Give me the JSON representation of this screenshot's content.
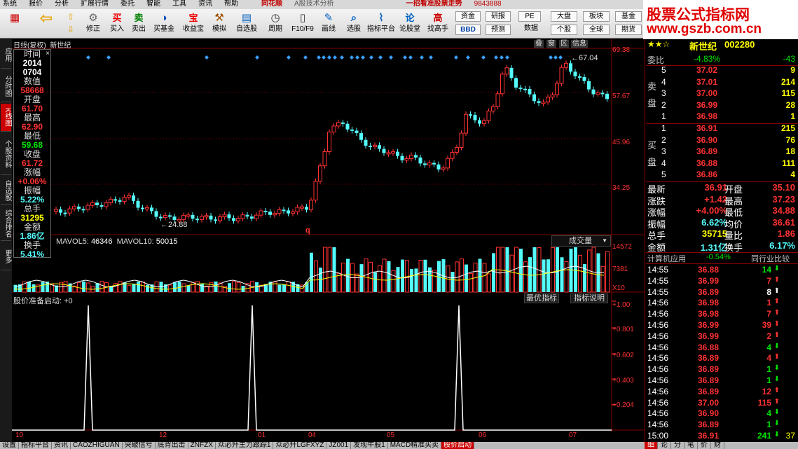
{
  "menu": [
    "系统",
    "报价",
    "分析",
    "扩展行情",
    "委托",
    "智能",
    "工具",
    "资讯",
    "帮助"
  ],
  "app_title": "A股技术分析",
  "app_brand": "同花顺",
  "promo": "一招看准股票走势",
  "promo_num": "9843888",
  "logo": {
    "line1": "股票公式指标网",
    "line2": "www.gszb.com.cn"
  },
  "toolbar": {
    "buttons": [
      "",
      "",
      "修正",
      "买入",
      "卖出",
      "买基金",
      "收益宝",
      "模拟",
      "自选股",
      "周期",
      "F10/F9",
      "画线",
      "选股",
      "指标平台",
      "论股堂",
      "找高手",
      "",
      "数据"
    ],
    "small": [
      "资金",
      "研报",
      "大盘",
      "板块",
      "基金",
      "BBD",
      "预测",
      "个股",
      "全球",
      "期货",
      "PE"
    ]
  },
  "chart_title": "日线(复权)",
  "stock_name_left": "新世纪",
  "chart_tabs": [
    "叠",
    "窗",
    "区",
    "信息"
  ],
  "info": {
    "rows": [
      {
        "label": "时间",
        "value": "2014",
        "cls": "white"
      },
      {
        "label": "",
        "value": "0704",
        "cls": "white"
      },
      {
        "label": "数值",
        "value": "58668",
        "cls": "red"
      },
      {
        "label": "开盘",
        "value": "61.70",
        "cls": "red"
      },
      {
        "label": "最高",
        "value": "62.90",
        "cls": "red"
      },
      {
        "label": "最低",
        "value": "59.68",
        "cls": "green"
      },
      {
        "label": "收盘",
        "value": "61.72",
        "cls": "red"
      },
      {
        "label": "涨幅",
        "value": "+0.06%",
        "cls": "red"
      },
      {
        "label": "振幅",
        "value": "5.22%",
        "cls": "cyan"
      },
      {
        "label": "总手",
        "value": "31295",
        "cls": "yellow"
      },
      {
        "label": "金额",
        "value": "1.86亿",
        "cls": "cyan"
      },
      {
        "label": "换手",
        "value": "5.41%",
        "cls": "cyan"
      }
    ]
  },
  "price_axis": [
    "69.38",
    "57.67",
    "45.96",
    "34.25"
  ],
  "annotations": {
    "high": "67.04",
    "low": "24.88"
  },
  "volume": {
    "legend_ma5_label": "MAVOL5:",
    "legend_ma5": "46346",
    "legend_ma10_label": "MAVOL10:",
    "legend_ma10": "50015",
    "select": "成交量",
    "axis": [
      "14572",
      "7381",
      "X10"
    ]
  },
  "indicator": {
    "legend": "股价准备启动: +0",
    "btn1": "最优指标",
    "btn2": "指标说明",
    "axis": [
      "+1.00",
      "+0.801",
      "+0.602",
      "+0.403",
      "+0.204"
    ]
  },
  "x_axis": [
    "10",
    "12",
    "01",
    "04",
    "05",
    "06",
    "07"
  ],
  "left_tabs": [
    "应用",
    "分时图",
    "K线图",
    "个股资料",
    "自选股",
    "综合排名",
    "更多"
  ],
  "bottom_tabs": [
    "设置",
    "指标平台",
    "资讯",
    "CAOZHIGUAN",
    "突破信号",
    "底背出击",
    "ZNFZX",
    "众必升主力跟踪1",
    "众必升LGFXYZ",
    "JZ001",
    "发现牛股1",
    "MACD精准买卖",
    "股价启动"
  ],
  "right_bottom_tabs": [
    "细",
    "论",
    "分",
    "笔",
    "价",
    "财"
  ],
  "quote": {
    "name": "新世纪",
    "code": "002280",
    "weibi_label": "委比",
    "weibi": "-4.83%",
    "weicha": "-43",
    "sell_label": "卖盘",
    "buy_label": "买盘",
    "sell": [
      {
        "n": "5",
        "p": "37.02",
        "v": "9"
      },
      {
        "n": "4",
        "p": "37.01",
        "v": "214"
      },
      {
        "n": "3",
        "p": "37.00",
        "v": "115"
      },
      {
        "n": "2",
        "p": "36.99",
        "v": "28"
      },
      {
        "n": "1",
        "p": "36.98",
        "v": "1"
      }
    ],
    "buy": [
      {
        "n": "1",
        "p": "36.91",
        "v": "215"
      },
      {
        "n": "2",
        "p": "36.90",
        "v": "76"
      },
      {
        "n": "3",
        "p": "36.89",
        "v": "18"
      },
      {
        "n": "4",
        "p": "36.88",
        "v": "111"
      },
      {
        "n": "5",
        "p": "36.86",
        "v": "4"
      }
    ],
    "stats": [
      {
        "l1": "最新",
        "v1": "36.91",
        "c1": "red",
        "l2": "开盘",
        "v2": "35.10",
        "c2": "red"
      },
      {
        "l1": "涨跌",
        "v1": "+1.42",
        "c1": "red",
        "l2": "最高",
        "v2": "37.23",
        "c2": "red"
      },
      {
        "l1": "涨幅",
        "v1": "+4.00%",
        "c1": "red",
        "l2": "最低",
        "v2": "34.88",
        "c2": "red"
      },
      {
        "l1": "振幅",
        "v1": "6.62%",
        "c1": "cyan",
        "l2": "均价",
        "v2": "36.61",
        "c2": "red"
      },
      {
        "l1": "总手",
        "v1": "35715",
        "c1": "yellow",
        "l2": "量比",
        "v2": "1.86",
        "c2": "red"
      },
      {
        "l1": "金额",
        "v1": "1.31亿",
        "c1": "cyan",
        "l2": "换手",
        "v2": "6.17%",
        "c2": "cyan"
      }
    ],
    "sector": "计算机应用",
    "sector_chg": "-0.54%",
    "peer": "同行业比较",
    "ticks": [
      {
        "t": "14:55",
        "p": "36.88",
        "v": "14",
        "d": "dn"
      },
      {
        "t": "14:55",
        "p": "36.99",
        "v": "7",
        "d": "up"
      },
      {
        "t": "14:55",
        "p": "36.89",
        "v": "8",
        "d": "w"
      },
      {
        "t": "14:56",
        "p": "36.98",
        "v": "1",
        "d": "up"
      },
      {
        "t": "14:56",
        "p": "36.98",
        "v": "7",
        "d": "up"
      },
      {
        "t": "14:56",
        "p": "36.99",
        "v": "39",
        "d": "up"
      },
      {
        "t": "14:56",
        "p": "36.99",
        "v": "2",
        "d": "up"
      },
      {
        "t": "14:56",
        "p": "36.88",
        "v": "4",
        "d": "dn"
      },
      {
        "t": "14:56",
        "p": "36.89",
        "v": "4",
        "d": "up"
      },
      {
        "t": "14:56",
        "p": "36.89",
        "v": "1",
        "d": "dn"
      },
      {
        "t": "14:56",
        "p": "36.89",
        "v": "1",
        "d": "dn"
      },
      {
        "t": "14:56",
        "p": "36.89",
        "v": "12",
        "d": "up"
      },
      {
        "t": "14:56",
        "p": "37.00",
        "v": "115",
        "d": "up"
      },
      {
        "t": "14:56",
        "p": "36.90",
        "v": "4",
        "d": "dn"
      },
      {
        "t": "14:56",
        "p": "36.89",
        "v": "1",
        "d": "dn"
      },
      {
        "t": "15:00",
        "p": "36.91",
        "v": "241",
        "d": "dn"
      }
    ],
    "last_tick_extra": "37"
  },
  "colors": {
    "up": "#ff3232",
    "down": "#54fcfc",
    "bg": "#000000",
    "axis": "#800000"
  }
}
